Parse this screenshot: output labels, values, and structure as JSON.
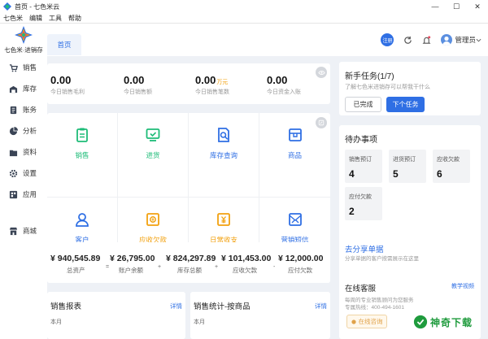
{
  "window": {
    "title": "首页 - 七色米云",
    "minimize": "—",
    "maximize": "☐",
    "close": "✕"
  },
  "menu": [
    "七色米",
    "编辑",
    "工具",
    "帮助"
  ],
  "logo": {
    "text": "七色米·进销存"
  },
  "sidebar": {
    "items": [
      {
        "label": "销售",
        "icon": "cart-icon"
      },
      {
        "label": "库存",
        "icon": "warehouse-icon"
      },
      {
        "label": "账务",
        "icon": "ledger-icon"
      },
      {
        "label": "分析",
        "icon": "chart-icon"
      },
      {
        "label": "资料",
        "icon": "folder-icon"
      },
      {
        "label": "设置",
        "icon": "gear-icon"
      },
      {
        "label": "应用",
        "icon": "apps-icon"
      },
      {
        "label": "商城",
        "icon": "store-icon"
      }
    ]
  },
  "header": {
    "tab": "首页",
    "badge": "注册",
    "user": "管理员"
  },
  "stats": [
    {
      "value": "0.00",
      "unit": "",
      "label": "今日销售毛利"
    },
    {
      "value": "0.00",
      "unit": "",
      "label": "今日销售额"
    },
    {
      "value": "0.00",
      "unit": "万元",
      "label": "今日销售笔数"
    },
    {
      "value": "0.00",
      "unit": "",
      "label": "今日资金入账"
    }
  ],
  "shortcuts": [
    {
      "label": "销售",
      "color": "green",
      "icon": "sales-icon"
    },
    {
      "label": "进货",
      "color": "green",
      "icon": "purchase-icon"
    },
    {
      "label": "库存查询",
      "color": "blue",
      "icon": "stock-search-icon"
    },
    {
      "label": "商品",
      "color": "blue",
      "icon": "product-icon"
    },
    {
      "label": "客户",
      "color": "blue",
      "icon": "customer-icon"
    },
    {
      "label": "应收欠款",
      "color": "orange",
      "icon": "receivable-icon"
    },
    {
      "label": "日常收支",
      "color": "orange",
      "icon": "daily-finance-icon"
    },
    {
      "label": "营销短信",
      "color": "blue",
      "icon": "sms-icon"
    }
  ],
  "balance": {
    "items": [
      {
        "value": "¥ 940,545.89",
        "label": "总资产"
      },
      {
        "value": "¥ 26,795.00",
        "label": "账户余额"
      },
      {
        "value": "¥ 824,297.89",
        "label": "库存总额"
      },
      {
        "value": "¥ 101,453.00",
        "label": "应收欠款"
      },
      {
        "value": "¥ 12,000.00",
        "label": "应付欠款"
      }
    ],
    "ops": [
      "=",
      "+",
      "+",
      "-"
    ]
  },
  "reports": [
    {
      "title": "销售报表",
      "link": "详情",
      "sub": "本月"
    },
    {
      "title": "销售统计-按商品",
      "link": "详情",
      "sub": "本月"
    }
  ],
  "newbie": {
    "title": "新手任务(1/7)",
    "desc": "了解七色米进销存可以帮我干什么",
    "done": "已完成",
    "next": "下个任务"
  },
  "todo": {
    "title": "待办事项",
    "items": [
      {
        "label": "销售预订",
        "value": "4"
      },
      {
        "label": "进货预订",
        "value": "5"
      },
      {
        "label": "应收欠款",
        "value": "6"
      },
      {
        "label": "应付欠款",
        "value": "2"
      }
    ]
  },
  "share": {
    "title": "去分享单据",
    "desc": "分享单据的客户按需展示在这里"
  },
  "service": {
    "title": "在线客服",
    "link": "教学视频",
    "line1": "每周的专业销售顾问为您服务",
    "line2": "专属热线：400-494-1601",
    "button": "在线咨询"
  },
  "watermark": {
    "text": "神奇下载"
  },
  "colors": {
    "accent": "#2f6fe4",
    "green": "#1ebc78",
    "orange": "#f2a10f",
    "background": "#eef1f6"
  }
}
